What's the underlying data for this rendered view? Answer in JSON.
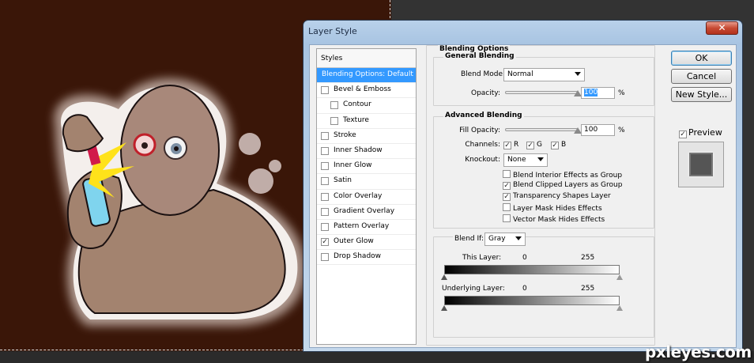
{
  "dialog": {
    "title": "Layer Style",
    "close_glyph": "✕"
  },
  "styles": {
    "header": "Styles",
    "items": [
      {
        "label": "Blending Options: Default",
        "checked": null,
        "selected": true,
        "sub": false
      },
      {
        "label": "Bevel & Emboss",
        "checked": false,
        "selected": false,
        "sub": false
      },
      {
        "label": "Contour",
        "checked": false,
        "selected": false,
        "sub": true
      },
      {
        "label": "Texture",
        "checked": false,
        "selected": false,
        "sub": true
      },
      {
        "label": "Stroke",
        "checked": false,
        "selected": false,
        "sub": false
      },
      {
        "label": "Inner Shadow",
        "checked": false,
        "selected": false,
        "sub": false
      },
      {
        "label": "Inner Glow",
        "checked": false,
        "selected": false,
        "sub": false
      },
      {
        "label": "Satin",
        "checked": false,
        "selected": false,
        "sub": false
      },
      {
        "label": "Color Overlay",
        "checked": false,
        "selected": false,
        "sub": false
      },
      {
        "label": "Gradient Overlay",
        "checked": false,
        "selected": false,
        "sub": false
      },
      {
        "label": "Pattern Overlay",
        "checked": false,
        "selected": false,
        "sub": false
      },
      {
        "label": "Outer Glow",
        "checked": true,
        "selected": false,
        "sub": false
      },
      {
        "label": "Drop Shadow",
        "checked": false,
        "selected": false,
        "sub": false
      }
    ]
  },
  "blending": {
    "section_title": "Blending Options",
    "general": {
      "title": "General Blending",
      "mode_label": "Blend Mode:",
      "mode_value": "Normal",
      "opacity_label": "Opacity:",
      "opacity_value": "100",
      "opacity_fraction": 1.0,
      "percent": "%"
    },
    "advanced": {
      "title": "Advanced Blending",
      "fill_label": "Fill Opacity:",
      "fill_value": "100",
      "fill_fraction": 1.0,
      "percent": "%",
      "channels_label": "Channels:",
      "channels": [
        {
          "label": "R",
          "checked": true
        },
        {
          "label": "G",
          "checked": true
        },
        {
          "label": "B",
          "checked": true
        }
      ],
      "knockout_label": "Knockout:",
      "knockout_value": "None",
      "options": [
        {
          "label": "Blend Interior Effects as Group",
          "checked": false
        },
        {
          "label": "Blend Clipped Layers as Group",
          "checked": true
        },
        {
          "label": "Transparency Shapes Layer",
          "checked": true
        },
        {
          "label": "Layer Mask Hides Effects",
          "checked": false
        },
        {
          "label": "Vector Mask Hides Effects",
          "checked": false
        }
      ]
    },
    "blend_if": {
      "label": "Blend If:",
      "value": "Gray",
      "this_layer_label": "This Layer:",
      "this_layer_min": "0",
      "this_layer_max": "255",
      "underlying_label": "Underlying Layer:",
      "underlying_min": "0",
      "underlying_max": "255"
    }
  },
  "buttons": {
    "ok": "OK",
    "cancel": "Cancel",
    "new_style": "New Style...",
    "preview_label": "Preview",
    "preview_checked": true
  },
  "watermark": "pxleyes.com",
  "colors": {
    "selection": "#3399ff",
    "canvas_bg": "#3a1608",
    "close_button": "#c74a33"
  }
}
